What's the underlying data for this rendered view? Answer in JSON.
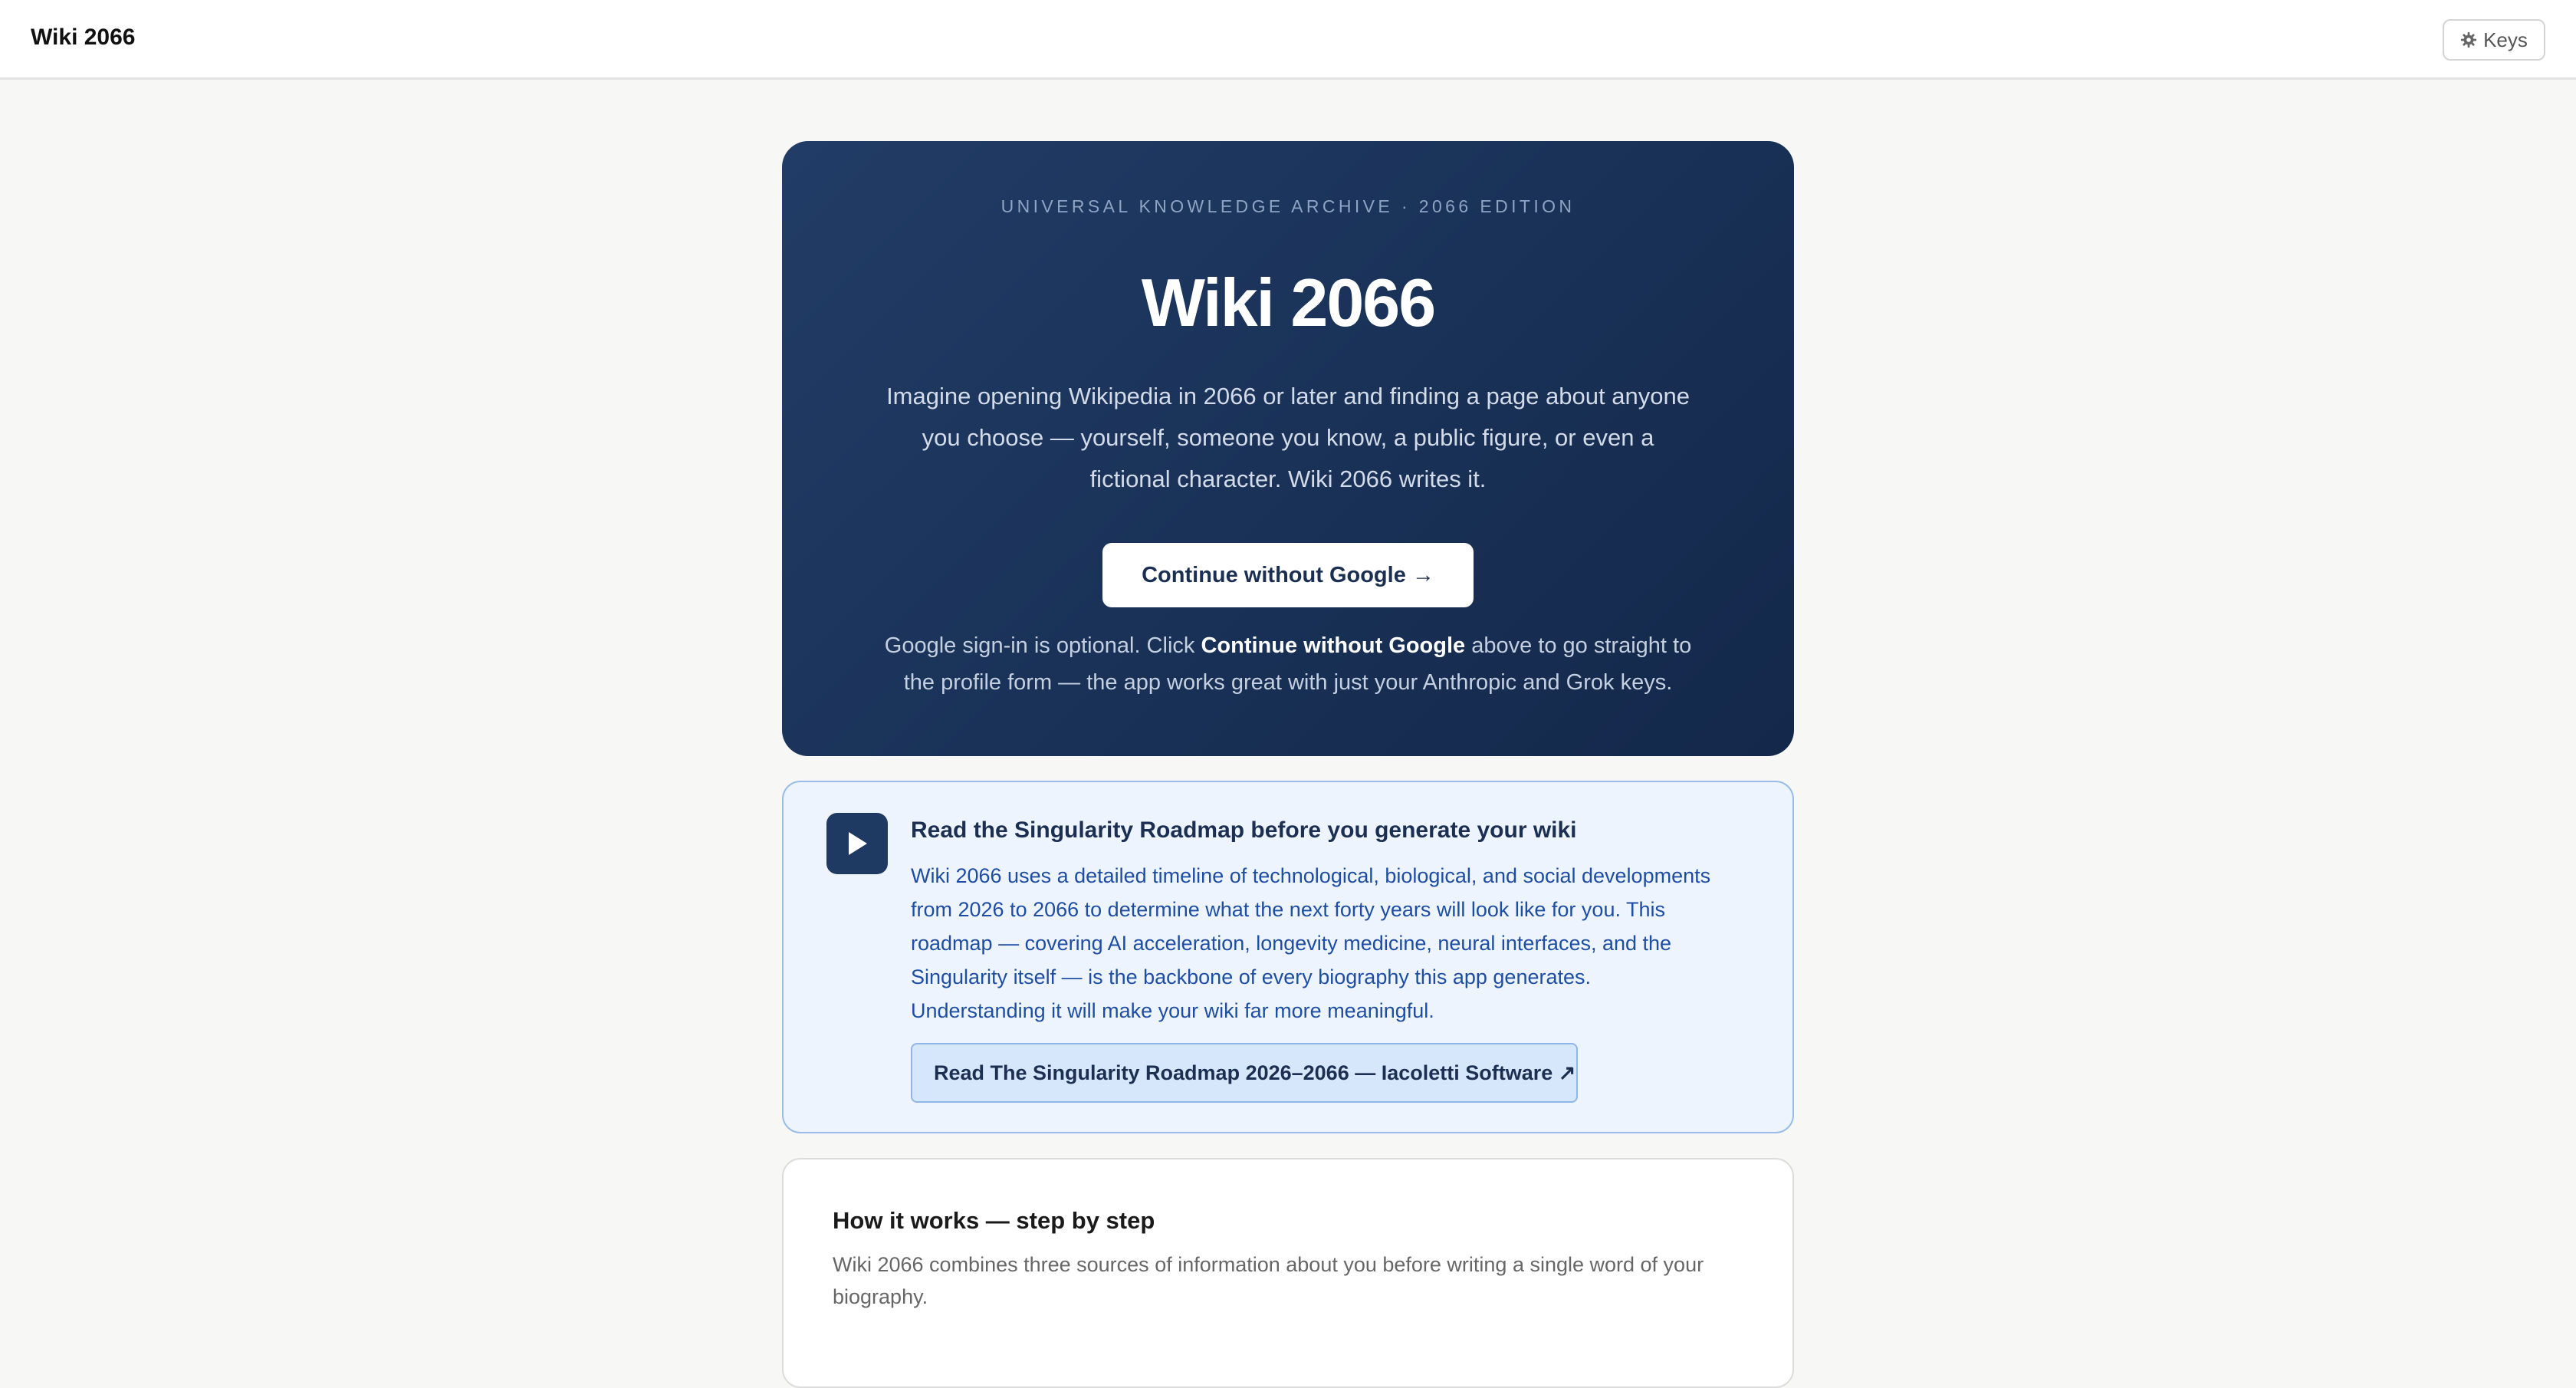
{
  "header": {
    "brand": "Wiki 2066",
    "keys_label": "Keys"
  },
  "hero": {
    "kicker": "UNIVERSAL KNOWLEDGE ARCHIVE · 2066 EDITION",
    "title": "Wiki 2066",
    "description": "Imagine opening Wikipedia in 2066 or later and finding a page about anyone you choose — yourself, someone you know, a public figure, or even a fictional character. Wiki 2066 writes it.",
    "cta_label": "Continue without Google →",
    "note_before": "Google sign-in is optional. Click ",
    "note_bold": "Continue without Google",
    "note_after": " above to go straight to the profile form — the app works great with just your Anthropic and Grok keys."
  },
  "roadmap": {
    "icon": "play-icon",
    "title": "Read the Singularity Roadmap before you generate your wiki",
    "body": "Wiki 2066 uses a detailed timeline of technological, biological, and social developments from 2026 to 2066 to determine what the next forty years will look like for you. This roadmap — covering AI acceleration, longevity medicine, neural interfaces, and the Singularity itself — is the backbone of every biography this app generates. Understanding it will make your wiki far more meaningful.",
    "link_label": "Read The Singularity Roadmap 2026–2066 — Iacoletti Software ↗"
  },
  "how_it_works": {
    "title": "How it works — step by step",
    "description": "Wiki 2066 combines three sources of information about you before writing a single word of your biography."
  },
  "colors": {
    "hero_bg": "#1a3258",
    "roadmap_bg": "#eef4fd",
    "roadmap_text": "#1d4ea3",
    "page_bg": "#f7f7f5"
  }
}
